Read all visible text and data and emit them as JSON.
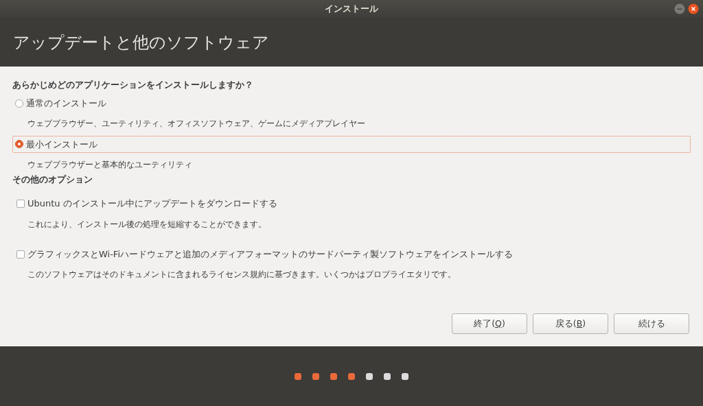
{
  "window": {
    "title": "インストール"
  },
  "header": {
    "title": "アップデートと他のソフトウェア"
  },
  "install_type": {
    "question": "あらかじめどのアプリケーションをインストールしますか？",
    "options": [
      {
        "label": "通常のインストール",
        "description": "ウェブブラウザー、ユーティリティ、オフィスソフトウェア、ゲームにメディアプレイヤー",
        "selected": false,
        "focused": false
      },
      {
        "label": "最小インストール",
        "description": "ウェブブラウザーと基本的なユーティリティ",
        "selected": true,
        "focused": true
      }
    ]
  },
  "other_options": {
    "heading": "その他のオプション",
    "items": [
      {
        "label": "Ubuntu のインストール中にアップデートをダウンロードする",
        "description": "これにより、インストール後の処理を短縮することができます。",
        "checked": false
      },
      {
        "label": "グラフィックスとWi-Fiハードウェアと追加のメディアフォーマットのサードパーティ製ソフトウェアをインストールする",
        "description": "このソフトウェアはそのドキュメントに含まれるライセンス規約に基づきます。いくつかはプロプライエタリです。",
        "checked": false
      }
    ]
  },
  "buttons": [
    {
      "before": "終了(",
      "mnemonic": "Q",
      "after": ")"
    },
    {
      "before": "戻る(",
      "mnemonic": "B",
      "after": ")"
    },
    {
      "before": "続ける"
    }
  ],
  "progress": [
    {
      "done": true
    },
    {
      "done": true
    },
    {
      "done": true
    },
    {
      "done": true
    },
    {
      "done": false
    },
    {
      "done": false
    },
    {
      "done": false
    }
  ]
}
